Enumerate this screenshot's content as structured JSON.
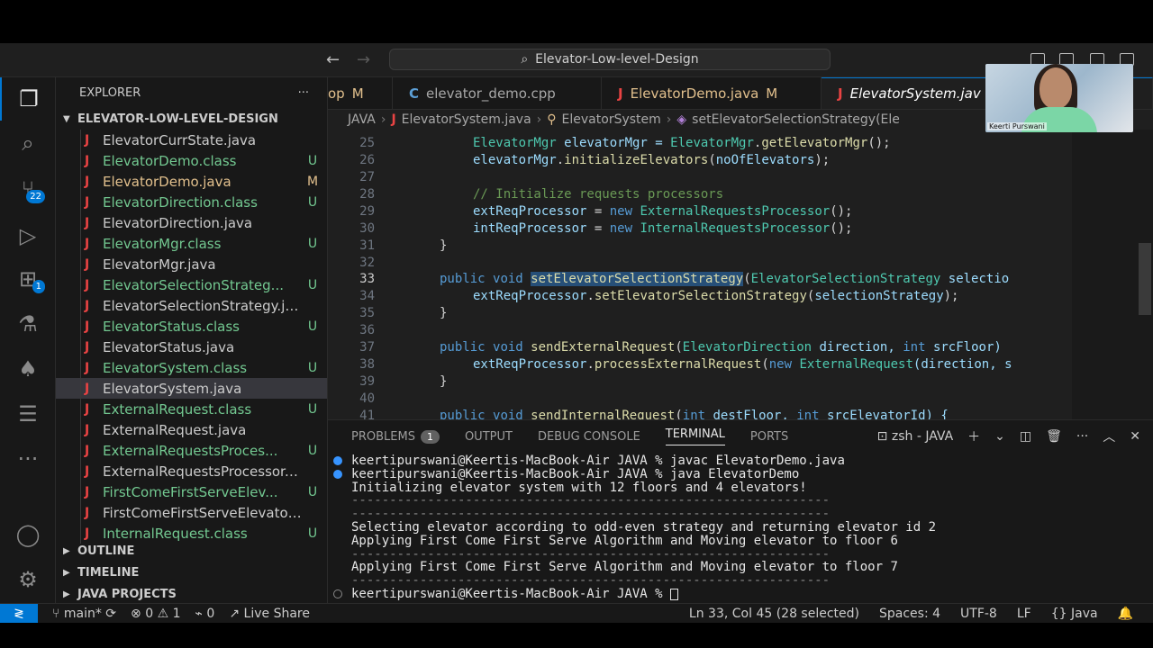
{
  "window": {
    "search_title": "Elevator-Low-level-Design"
  },
  "activity": {
    "scm_badge": "22",
    "extensions_badge": "1"
  },
  "explorer": {
    "title": "EXPLORER",
    "more": "···",
    "root": "ELEVATOR-LOW-LEVEL-DESIGN",
    "files": [
      {
        "name": "ElevatorCurrState.java",
        "status": "",
        "kind": "n"
      },
      {
        "name": "ElevatorDemo.class",
        "status": "U",
        "kind": "u"
      },
      {
        "name": "ElevatorDemo.java",
        "status": "M",
        "kind": "m"
      },
      {
        "name": "ElevatorDirection.class",
        "status": "U",
        "kind": "u"
      },
      {
        "name": "ElevatorDirection.java",
        "status": "",
        "kind": "n"
      },
      {
        "name": "ElevatorMgr.class",
        "status": "U",
        "kind": "u"
      },
      {
        "name": "ElevatorMgr.java",
        "status": "",
        "kind": "n"
      },
      {
        "name": "ElevatorSelectionStrateg...",
        "status": "U",
        "kind": "u"
      },
      {
        "name": "ElevatorSelectionStrategy.java",
        "status": "",
        "kind": "n"
      },
      {
        "name": "ElevatorStatus.class",
        "status": "U",
        "kind": "u"
      },
      {
        "name": "ElevatorStatus.java",
        "status": "",
        "kind": "n"
      },
      {
        "name": "ElevatorSystem.class",
        "status": "U",
        "kind": "u"
      },
      {
        "name": "ElevatorSystem.java",
        "status": "",
        "kind": "n"
      },
      {
        "name": "ExternalRequest.class",
        "status": "U",
        "kind": "u"
      },
      {
        "name": "ExternalRequest.java",
        "status": "",
        "kind": "n"
      },
      {
        "name": "ExternalRequestsProces...",
        "status": "U",
        "kind": "u"
      },
      {
        "name": "ExternalRequestsProcessor.ja...",
        "status": "",
        "kind": "n"
      },
      {
        "name": "FirstComeFirstServeElev...",
        "status": "U",
        "kind": "u"
      },
      {
        "name": "FirstComeFirstServeElevator...",
        "status": "",
        "kind": "n"
      },
      {
        "name": "InternalRequest.class",
        "status": "U",
        "kind": "u"
      }
    ],
    "outline": "OUTLINE",
    "timeline": "TIMELINE",
    "java_projects": "JAVA PROJECTS"
  },
  "tabs": [
    {
      "label": "op",
      "status": "M",
      "icon": "",
      "kind": "m"
    },
    {
      "label": "elevator_demo.cpp",
      "status": "",
      "icon": "C",
      "kind": "n"
    },
    {
      "label": "ElevatorDemo.java",
      "status": "M",
      "icon": "J",
      "kind": "m"
    },
    {
      "label": "ElevatorSystem.jav",
      "status": "",
      "icon": "J",
      "kind": "active"
    }
  ],
  "breadcrumb": {
    "folder": "JAVA",
    "file": "ElevatorSystem.java",
    "class": "ElevatorSystem",
    "method": "setElevatorSelectionStrategy(Ele"
  },
  "code": {
    "line_numbers": [
      "25",
      "26",
      "27",
      "28",
      "29",
      "30",
      "31",
      "32",
      "33",
      "34",
      "35",
      "36",
      "37",
      "38",
      "39",
      "40",
      "41"
    ],
    "l25a": "ElevatorMgr",
    "l25b": " elevatorMgr = ",
    "l25c": "ElevatorMgr",
    "l25d": ".",
    "l25e": "getElevatorMgr",
    "l25f": "();",
    "l26a": "elevatorMgr",
    "l26b": ".",
    "l26c": "initializeElevators",
    "l26d": "(",
    "l26e": "noOfElevators",
    "l26f": ");",
    "l28": "// Initialize requests processors",
    "l29a": "extReqProcessor",
    "l29b": " = ",
    "l29c": "new",
    "l29d": " ",
    "l29e": "ExternalRequestsProcessor",
    "l29f": "();",
    "l30a": "intReqProcessor",
    "l30b": " = ",
    "l30c": "new",
    "l30d": " ",
    "l30e": "InternalRequestsProcessor",
    "l30f": "();",
    "l31": "}",
    "l33a": "public",
    "l33b": "void",
    "l33c": "setElevatorSelectionStrategy",
    "l33d": "(",
    "l33e": "ElevatorSelectionStrategy",
    "l33f": " selectio",
    "l34a": "extReqProcessor",
    "l34b": ".",
    "l34c": "setElevatorSelectionStrategy",
    "l34d": "(",
    "l34e": "selectionStrategy",
    "l34f": ");",
    "l35": "}",
    "l37a": "public",
    "l37b": "void",
    "l37c": "sendExternalRequest",
    "l37d": "(",
    "l37e": "ElevatorDirection",
    "l37f": " direction, ",
    "l37g": "int",
    "l37h": " srcFloor)",
    "l38a": "extReqProcessor",
    "l38b": ".",
    "l38c": "processExternalRequest",
    "l38d": "(",
    "l38e": "new",
    "l38f": " ",
    "l38g": "ExternalRequest",
    "l38h": "(direction, s",
    "l39": "}",
    "l41a": "public",
    "l41b": "void",
    "l41c": "sendInternalRequest",
    "l41d": "(",
    "l41e": "int",
    "l41f": " destFloor, ",
    "l41g": "int",
    "l41h": " srcElevatorId) {"
  },
  "panel": {
    "tabs": [
      "PROBLEMS",
      "OUTPUT",
      "DEBUG CONSOLE",
      "TERMINAL",
      "PORTS"
    ],
    "problems_count": "1",
    "shell": "zsh - JAVA",
    "terminal": [
      "keertipurswani@Keertis-MacBook-Air JAVA % javac ElevatorDemo.java",
      "keertipurswani@Keertis-MacBook-Air JAVA % java ElevatorDemo",
      "Initializing elevator system with 12 floors and 4 elevators!",
      "---------------------------------------------------------------",
      "---------------------------------------------------------------",
      "Selecting elevator according to odd-even strategy and returning elevator id 2",
      "Applying First Come First Serve Algorithm and Moving elevator to floor 6",
      "---------------------------------------------------------------",
      "Applying First Come First Serve Algorithm and Moving elevator to floor 7",
      "---------------------------------------------------------------",
      "keertipurswani@Keertis-MacBook-Air JAVA % "
    ]
  },
  "status": {
    "branch": "main*",
    "errors": "0",
    "warnings": "1",
    "ports": "0",
    "live_share": "Live Share",
    "position": "Ln 33, Col 45 (28 selected)",
    "spaces": "Spaces: 4",
    "encoding": "UTF-8",
    "eol": "LF",
    "language": "Java"
  },
  "webcam": {
    "name": "Keerti Purswani"
  },
  "colors": {
    "accent": "#0078d4",
    "untracked": "#73c991",
    "modified": "#e2c08d",
    "java_icon": "#e84343"
  }
}
